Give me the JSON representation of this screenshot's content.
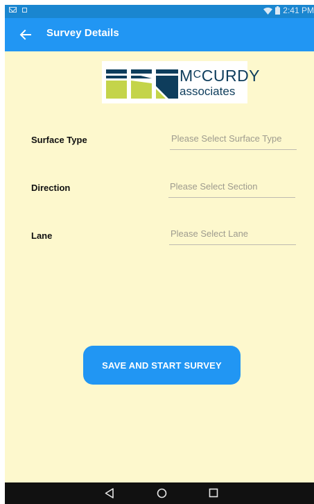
{
  "status_bar": {
    "time": "2:41 PM",
    "icons": [
      "mail-icon",
      "notification-icon",
      "wifi-icon",
      "battery-icon"
    ]
  },
  "app_bar": {
    "title": "Survey Details",
    "back_icon": "arrow-left-icon"
  },
  "logo": {
    "line1_big": "M",
    "line1_small": "C",
    "line1_rest": "CURDY",
    "line2": "associates"
  },
  "form": {
    "fields": [
      {
        "label": "Surface Type",
        "placeholder": "Please Select Surface Type"
      },
      {
        "label": "Direction",
        "placeholder": "Please Select Section"
      },
      {
        "label": "Lane",
        "placeholder": "Please Select Lane"
      }
    ]
  },
  "actions": {
    "save_label": "SAVE AND START SURVEY"
  },
  "nav_bar": {
    "icons": [
      "back-triangle-icon",
      "home-circle-icon",
      "recents-square-icon"
    ]
  },
  "colors": {
    "primary": "#2196f3",
    "background": "#fdf8cd",
    "logo_navy": "#0e3d5c",
    "logo_green": "#c4d44a"
  }
}
